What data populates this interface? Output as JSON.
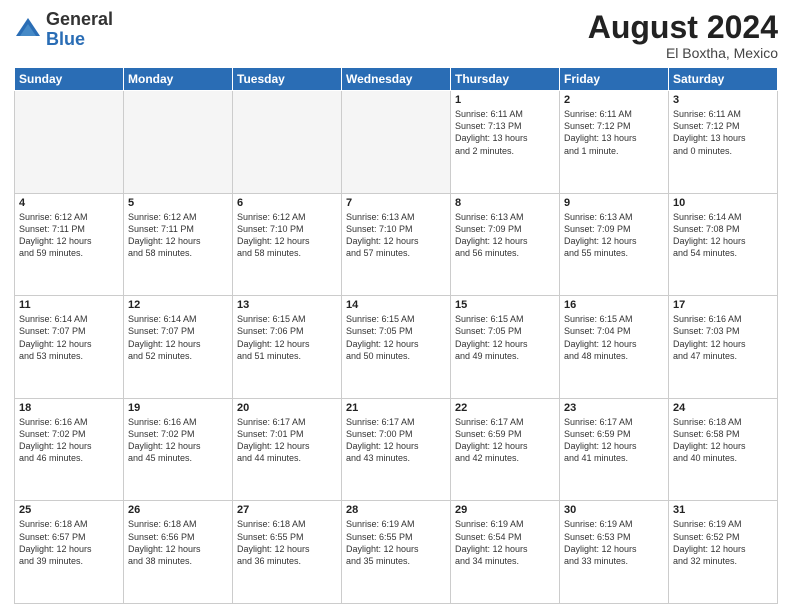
{
  "logo": {
    "general": "General",
    "blue": "Blue"
  },
  "header": {
    "month_year": "August 2024",
    "location": "El Boxtha, Mexico"
  },
  "days_of_week": [
    "Sunday",
    "Monday",
    "Tuesday",
    "Wednesday",
    "Thursday",
    "Friday",
    "Saturday"
  ],
  "weeks": [
    [
      {
        "day": "",
        "info": ""
      },
      {
        "day": "",
        "info": ""
      },
      {
        "day": "",
        "info": ""
      },
      {
        "day": "",
        "info": ""
      },
      {
        "day": "1",
        "info": "Sunrise: 6:11 AM\nSunset: 7:13 PM\nDaylight: 13 hours\nand 2 minutes."
      },
      {
        "day": "2",
        "info": "Sunrise: 6:11 AM\nSunset: 7:12 PM\nDaylight: 13 hours\nand 1 minute."
      },
      {
        "day": "3",
        "info": "Sunrise: 6:11 AM\nSunset: 7:12 PM\nDaylight: 13 hours\nand 0 minutes."
      }
    ],
    [
      {
        "day": "4",
        "info": "Sunrise: 6:12 AM\nSunset: 7:11 PM\nDaylight: 12 hours\nand 59 minutes."
      },
      {
        "day": "5",
        "info": "Sunrise: 6:12 AM\nSunset: 7:11 PM\nDaylight: 12 hours\nand 58 minutes."
      },
      {
        "day": "6",
        "info": "Sunrise: 6:12 AM\nSunset: 7:10 PM\nDaylight: 12 hours\nand 58 minutes."
      },
      {
        "day": "7",
        "info": "Sunrise: 6:13 AM\nSunset: 7:10 PM\nDaylight: 12 hours\nand 57 minutes."
      },
      {
        "day": "8",
        "info": "Sunrise: 6:13 AM\nSunset: 7:09 PM\nDaylight: 12 hours\nand 56 minutes."
      },
      {
        "day": "9",
        "info": "Sunrise: 6:13 AM\nSunset: 7:09 PM\nDaylight: 12 hours\nand 55 minutes."
      },
      {
        "day": "10",
        "info": "Sunrise: 6:14 AM\nSunset: 7:08 PM\nDaylight: 12 hours\nand 54 minutes."
      }
    ],
    [
      {
        "day": "11",
        "info": "Sunrise: 6:14 AM\nSunset: 7:07 PM\nDaylight: 12 hours\nand 53 minutes."
      },
      {
        "day": "12",
        "info": "Sunrise: 6:14 AM\nSunset: 7:07 PM\nDaylight: 12 hours\nand 52 minutes."
      },
      {
        "day": "13",
        "info": "Sunrise: 6:15 AM\nSunset: 7:06 PM\nDaylight: 12 hours\nand 51 minutes."
      },
      {
        "day": "14",
        "info": "Sunrise: 6:15 AM\nSunset: 7:05 PM\nDaylight: 12 hours\nand 50 minutes."
      },
      {
        "day": "15",
        "info": "Sunrise: 6:15 AM\nSunset: 7:05 PM\nDaylight: 12 hours\nand 49 minutes."
      },
      {
        "day": "16",
        "info": "Sunrise: 6:15 AM\nSunset: 7:04 PM\nDaylight: 12 hours\nand 48 minutes."
      },
      {
        "day": "17",
        "info": "Sunrise: 6:16 AM\nSunset: 7:03 PM\nDaylight: 12 hours\nand 47 minutes."
      }
    ],
    [
      {
        "day": "18",
        "info": "Sunrise: 6:16 AM\nSunset: 7:02 PM\nDaylight: 12 hours\nand 46 minutes."
      },
      {
        "day": "19",
        "info": "Sunrise: 6:16 AM\nSunset: 7:02 PM\nDaylight: 12 hours\nand 45 minutes."
      },
      {
        "day": "20",
        "info": "Sunrise: 6:17 AM\nSunset: 7:01 PM\nDaylight: 12 hours\nand 44 minutes."
      },
      {
        "day": "21",
        "info": "Sunrise: 6:17 AM\nSunset: 7:00 PM\nDaylight: 12 hours\nand 43 minutes."
      },
      {
        "day": "22",
        "info": "Sunrise: 6:17 AM\nSunset: 6:59 PM\nDaylight: 12 hours\nand 42 minutes."
      },
      {
        "day": "23",
        "info": "Sunrise: 6:17 AM\nSunset: 6:59 PM\nDaylight: 12 hours\nand 41 minutes."
      },
      {
        "day": "24",
        "info": "Sunrise: 6:18 AM\nSunset: 6:58 PM\nDaylight: 12 hours\nand 40 minutes."
      }
    ],
    [
      {
        "day": "25",
        "info": "Sunrise: 6:18 AM\nSunset: 6:57 PM\nDaylight: 12 hours\nand 39 minutes."
      },
      {
        "day": "26",
        "info": "Sunrise: 6:18 AM\nSunset: 6:56 PM\nDaylight: 12 hours\nand 38 minutes."
      },
      {
        "day": "27",
        "info": "Sunrise: 6:18 AM\nSunset: 6:55 PM\nDaylight: 12 hours\nand 36 minutes."
      },
      {
        "day": "28",
        "info": "Sunrise: 6:19 AM\nSunset: 6:55 PM\nDaylight: 12 hours\nand 35 minutes."
      },
      {
        "day": "29",
        "info": "Sunrise: 6:19 AM\nSunset: 6:54 PM\nDaylight: 12 hours\nand 34 minutes."
      },
      {
        "day": "30",
        "info": "Sunrise: 6:19 AM\nSunset: 6:53 PM\nDaylight: 12 hours\nand 33 minutes."
      },
      {
        "day": "31",
        "info": "Sunrise: 6:19 AM\nSunset: 6:52 PM\nDaylight: 12 hours\nand 32 minutes."
      }
    ]
  ]
}
